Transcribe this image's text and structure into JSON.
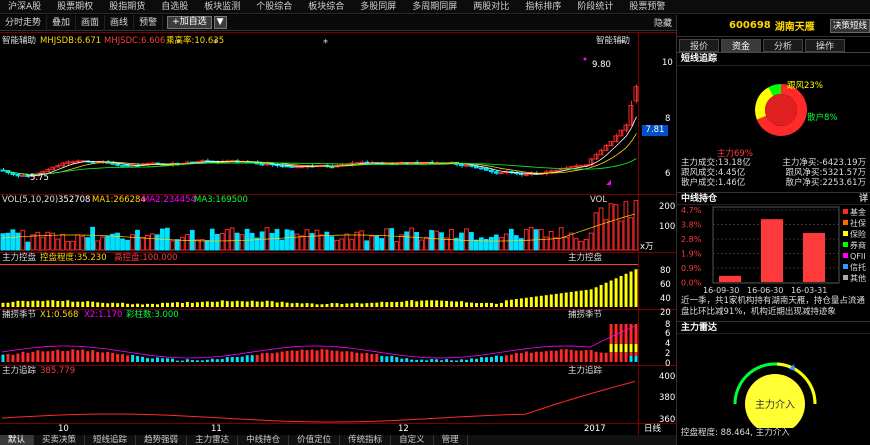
{
  "nav": [
    "沪深A股",
    "股票期权",
    "股指期货",
    "自选股",
    "板块监测",
    "个股综合",
    "板块综合",
    "多股同屏",
    "多周期同屏",
    "两股对比",
    "指标排序",
    "阶段统计",
    "股票预警"
  ],
  "toolbar": {
    "items": [
      "分时走势",
      "叠加",
      "画面",
      "画线",
      "预警"
    ],
    "add": "+加自选",
    "dropdown": "▼",
    "hide": "隐藏"
  },
  "main": {
    "label": "智能辅助",
    "mhjsdb": "MHJSDB:6.671",
    "mhjsdc": "MHJSDC:6.606",
    "rate": "乘高率:10.635",
    "right_label": "智能辅助",
    "y_ticks": [
      "10",
      "8",
      "6"
    ],
    "price_box": "7.81",
    "high": "9.80",
    "low": "5.75",
    "colors": {
      "up": "#ff2a2a",
      "down": "#00e0ff",
      "ma1": "#ffffff",
      "ma2": "#ffd700",
      "ma3": "#00ff3a"
    }
  },
  "vol": {
    "label": "VOL(5,10,20)",
    "v": "352708",
    "ma1": "MA1:266284",
    "ma2": "MA2:234454",
    "ma3": "MA3:169500",
    "right": "VOL",
    "y_ticks": [
      "200",
      "100"
    ],
    "unit": "x万"
  },
  "zlkp": {
    "name": "主力控盘",
    "deg": "控盘程度:35.230",
    "high": "高控盘:100.000",
    "right": "主力控盘",
    "y_ticks": [
      "80",
      "60",
      "40",
      "20"
    ]
  },
  "bzjj": {
    "name": "捕捞季节",
    "x1": "X1:0.568",
    "x2": "X2:1.170",
    "cz": "彩柱数:3.000",
    "right": "捕捞季节",
    "y_ticks": [
      "8",
      "6",
      "4",
      "2",
      "0"
    ]
  },
  "zlzz": {
    "name": "主力追踪",
    "val": "385.779",
    "right": "主力追踪",
    "y_ticks": [
      "400",
      "380",
      "360"
    ]
  },
  "xaxis": [
    "10",
    "11",
    "12",
    "2017"
  ],
  "sidetab": "日线",
  "bottom_tabs": [
    "默认",
    "买卖决策",
    "短线追踪",
    "趋势强弱",
    "主力雷达",
    "中线持仓",
    "价值定位",
    "传统指标",
    "自定义",
    "管理"
  ],
  "stock": {
    "code": "600698",
    "name": "湖南天雁",
    "btn": "决策短线"
  },
  "rtabs": [
    "报价",
    "资金",
    "分析",
    "操作"
  ],
  "short": {
    "title": "短线追踪",
    "pie": [
      {
        "label": "主力",
        "pct": 69,
        "color": "#ff2a2a"
      },
      {
        "label": "跟风",
        "pct": 23,
        "color": "#ffff00"
      },
      {
        "label": "散户",
        "pct": 8,
        "color": "#00ff00"
      }
    ],
    "labels": [
      "主力69%",
      "跟风23%",
      "散户8%"
    ],
    "rows": [
      [
        "主力成交:13.18亿",
        "主力净买:-6423.19万"
      ],
      [
        "跟风成交:4.45亿",
        "跟风净买:5321.57万"
      ],
      [
        "散户成交:1.46亿",
        "散户净买:2253.61万"
      ]
    ]
  },
  "mid": {
    "title": "中线持仓",
    "detail": "详",
    "yticks": [
      "4.7%",
      "3.8%",
      "2.8%",
      "1.9%",
      "0.9%",
      "0.0%"
    ],
    "xticks": [
      "16-09-30",
      "16-06-30",
      "16-03-31"
    ],
    "legend": [
      "基金",
      "社保",
      "保险",
      "券商",
      "QFII",
      "信托",
      "其他"
    ],
    "legend_colors": [
      "#ff2a2a",
      "#ff6600",
      "#ffff00",
      "#00ff00",
      "#ff00ff",
      "#3399ff",
      "#aaaaaa"
    ],
    "text": "近一季，共1家机构持有湖南天雁，持仓量占流通盘比环比减91%，机构近期出现减持迹象"
  },
  "radar": {
    "title": "主力雷达",
    "center": "主力介入",
    "deg": "控盘程度: 88.464, 主力介入"
  },
  "chart_data": [
    {
      "type": "bar",
      "title": "中线持仓",
      "categories": [
        "16-09-30",
        "16-06-30",
        "16-03-31"
      ],
      "values": [
        0.4,
        4.1,
        3.2
      ],
      "ylim": [
        0,
        4.7
      ]
    },
    {
      "type": "pie",
      "title": "短线追踪",
      "categories": [
        "主力",
        "跟风",
        "散户"
      ],
      "values": [
        69,
        23,
        8
      ]
    }
  ]
}
